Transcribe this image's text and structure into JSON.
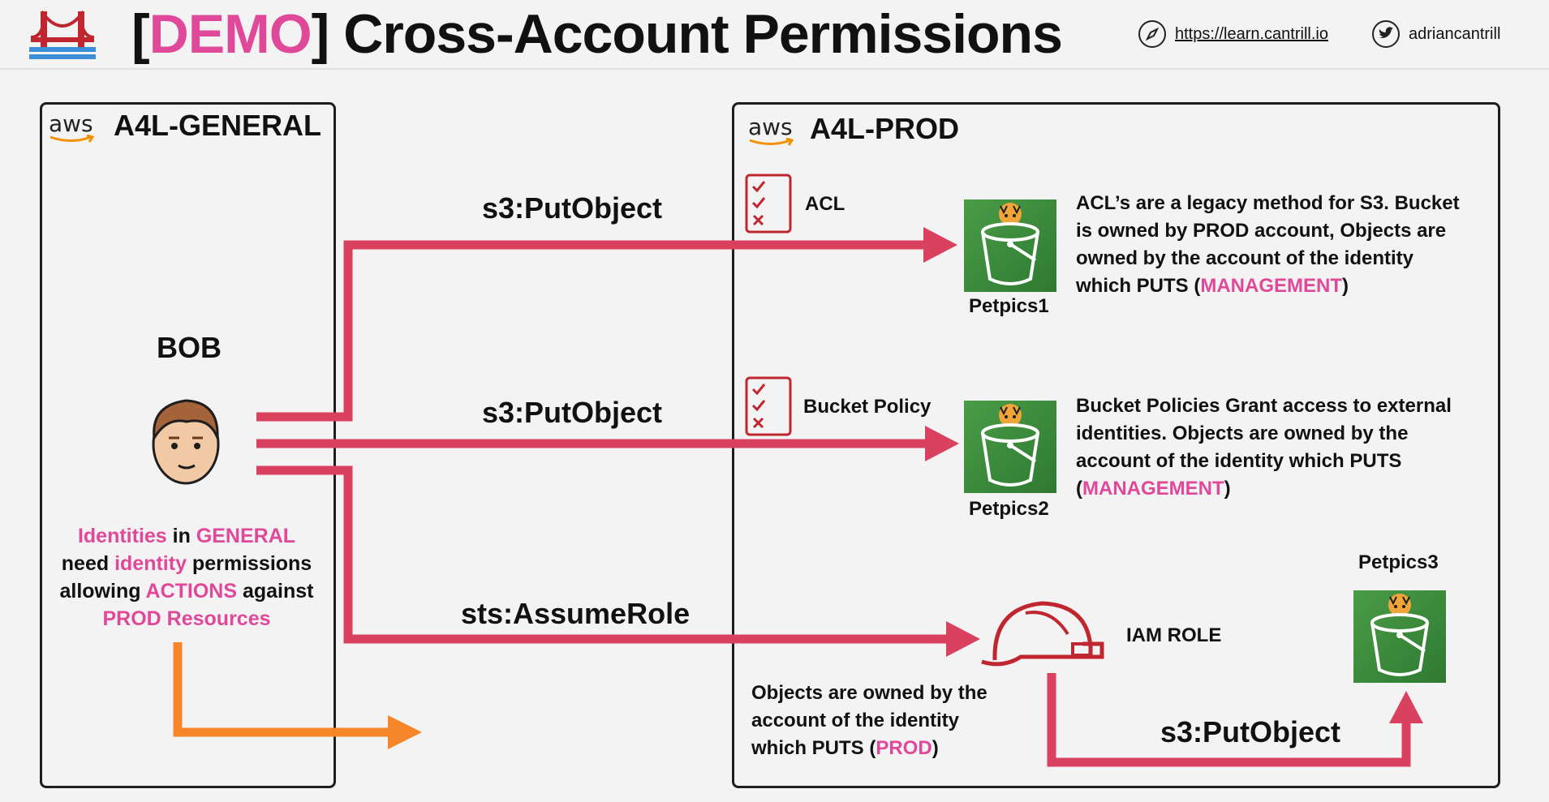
{
  "header": {
    "title_bracket_open": "[",
    "title_demo": "DEMO",
    "title_bracket_close": "]",
    "title_rest": " Cross-Account Permissions",
    "site_link": "https://learn.cantrill.io",
    "twitter_handle": "adriancantrill"
  },
  "accounts": {
    "general": {
      "aws_label": "aws",
      "name": "A4L-GENERAL"
    },
    "prod": {
      "aws_label": "aws",
      "name": "A4L-PROD"
    }
  },
  "bob": {
    "name": "BOB",
    "description": {
      "l1a": "Identities",
      "l1b": " in ",
      "l1c": "GENERAL",
      "l2a": "need ",
      "l2b": "identity",
      "l2c": " permissions",
      "l3a": "allowing ",
      "l3b": "ACTIONS",
      "l3c": " against",
      "l4": "PROD Resources"
    }
  },
  "actions": {
    "acl_put": "s3:PutObject",
    "policy_put": "s3:PutObject",
    "assume_role": "sts:AssumeRole",
    "role_put": "s3:PutObject"
  },
  "acl": {
    "label": "ACL",
    "bucket": "Petpics1",
    "desc_l1": "ACL’s are a legacy method for S3. Bucket",
    "desc_l2": "is owned by PROD account, Objects are",
    "desc_l3": "owned by the account of the identity",
    "desc_l4a": "which PUTS (",
    "desc_l4b": "MANAGEMENT",
    "desc_l4c": ")"
  },
  "bucket_policy": {
    "label": "Bucket Policy",
    "bucket": "Petpics2",
    "desc_l1": "Bucket Policies Grant access to external",
    "desc_l2": "identities. Objects are owned by the",
    "desc_l3": "account of the identity which PUTS",
    "desc_l4a": "(",
    "desc_l4b": "MANAGEMENT",
    "desc_l4c": ")"
  },
  "iam_role": {
    "label": "IAM ROLE",
    "bucket": "Petpics3",
    "desc_l1": "Objects are owned by the",
    "desc_l2": "account of the identity",
    "desc_l3a": "which PUTS (",
    "desc_l3b": "PROD",
    "desc_l3c": ")"
  },
  "colors": {
    "arrow_red": "#d9415f",
    "arrow_orange": "#f5862a",
    "accent_pink": "#e0489a",
    "bucket_green": "#3a8b3c"
  },
  "icons": {
    "logo": "golden-gate-bridge-icon",
    "site": "compass-icon",
    "twitter": "twitter-bird-icon",
    "checklist": "checklist-icon",
    "bucket": "s3-bucket-icon",
    "role": "hard-hat-icon",
    "user": "user-avatar-icon"
  }
}
